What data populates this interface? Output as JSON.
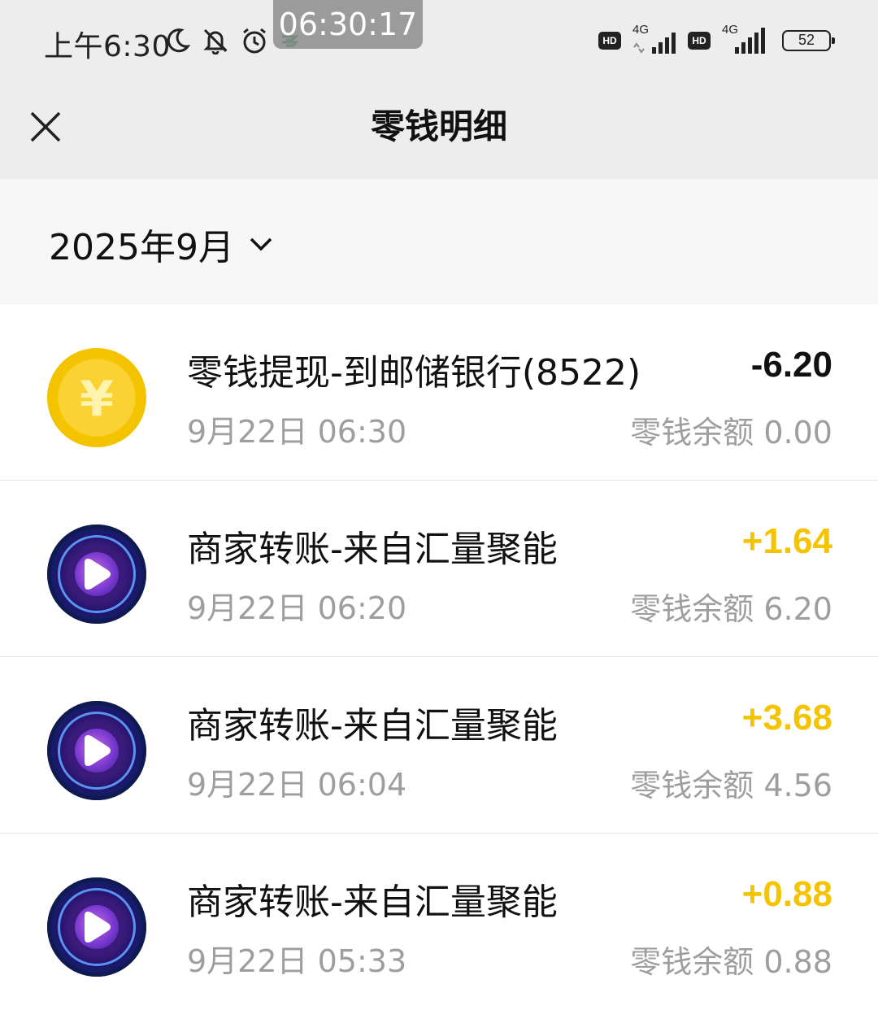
{
  "status_bar": {
    "time": "上午6:30",
    "overlay_clock": "06:30:17",
    "network_1": "4G",
    "network_2": "4G",
    "hd_1": "HD",
    "hd_2": "HD",
    "battery": "52",
    "icons": [
      "moon-icon",
      "bell-off-icon",
      "alarm-icon",
      "postal-bank-icon"
    ]
  },
  "header": {
    "title": "零钱明细",
    "close_icon": "close-icon"
  },
  "filter": {
    "month": "2025年9月",
    "dropdown_icon": "chevron-down-icon"
  },
  "transactions": [
    {
      "title": "零钱提现-到邮储银行(8522)",
      "time": "9月22日 06:30",
      "amount": "-6.20",
      "balance": "零钱余额 0.00",
      "icon": "yuan-coin-icon"
    },
    {
      "title": "商家转账-来自汇量聚能",
      "time": "9月22日 06:20",
      "amount": "+1.64",
      "balance": "零钱余额 6.20",
      "icon": "play-logo-icon"
    },
    {
      "title": "商家转账-来自汇量聚能",
      "time": "9月22日 06:04",
      "amount": "+3.68",
      "balance": "零钱余额 4.56",
      "icon": "play-logo-icon"
    },
    {
      "title": "商家转账-来自汇量聚能",
      "time": "9月22日 05:33",
      "amount": "+0.88",
      "balance": "零钱余额 0.88",
      "icon": "play-logo-icon"
    }
  ],
  "colors": {
    "header_bg": "#ededed",
    "filter_bg": "#f7f7f7",
    "income": "#f5c400",
    "expense": "#111111",
    "secondary_text": "#9e9e9e"
  }
}
